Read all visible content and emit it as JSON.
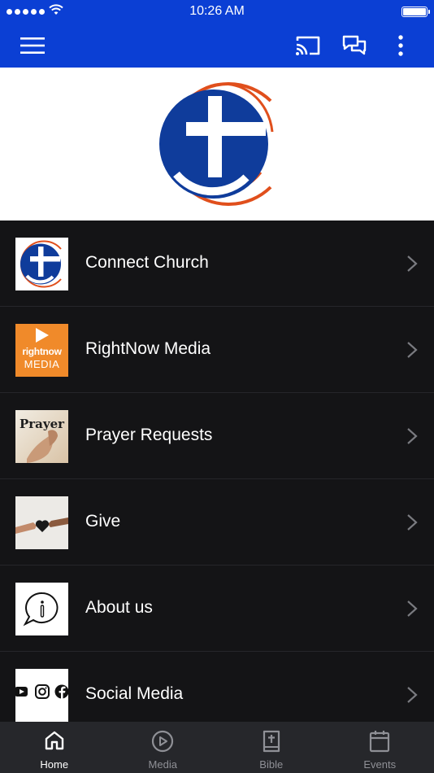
{
  "status_bar": {
    "time": "10:26 AM",
    "signal_icon": "signal-dots",
    "wifi_icon": "wifi-icon",
    "battery_icon": "battery-full-icon"
  },
  "app_bar": {
    "background": "#0b3fd4",
    "icons": [
      "hamburger-menu-icon",
      "cast-icon",
      "chat-bubbles-icon",
      "more-vertical-icon"
    ]
  },
  "logo": {
    "colors": {
      "blue": "#0f3c9b",
      "orange": "#e04f1c"
    }
  },
  "menu": {
    "items": [
      {
        "label": "Connect Church",
        "thumb": "church-logo"
      },
      {
        "label": "RightNow Media",
        "thumb": "rightnow-media-logo",
        "thumb_line1": "rightnow",
        "thumb_line2": "MEDIA",
        "color": "#f08a2a"
      },
      {
        "label": "Prayer Requests",
        "thumb": "prayer-image",
        "thumb_text": "Prayer"
      },
      {
        "label": "Give",
        "thumb": "give-heart-image"
      },
      {
        "label": "About us",
        "thumb": "info-speech-bubble-icon"
      },
      {
        "label": "Social Media",
        "thumb": "social-icons"
      }
    ]
  },
  "tabs": [
    {
      "label": "Home",
      "icon": "home-icon",
      "active": true
    },
    {
      "label": "Media",
      "icon": "play-circle-icon",
      "active": false
    },
    {
      "label": "Bible",
      "icon": "bible-icon",
      "active": false
    },
    {
      "label": "Events",
      "icon": "calendar-icon",
      "active": false
    }
  ]
}
